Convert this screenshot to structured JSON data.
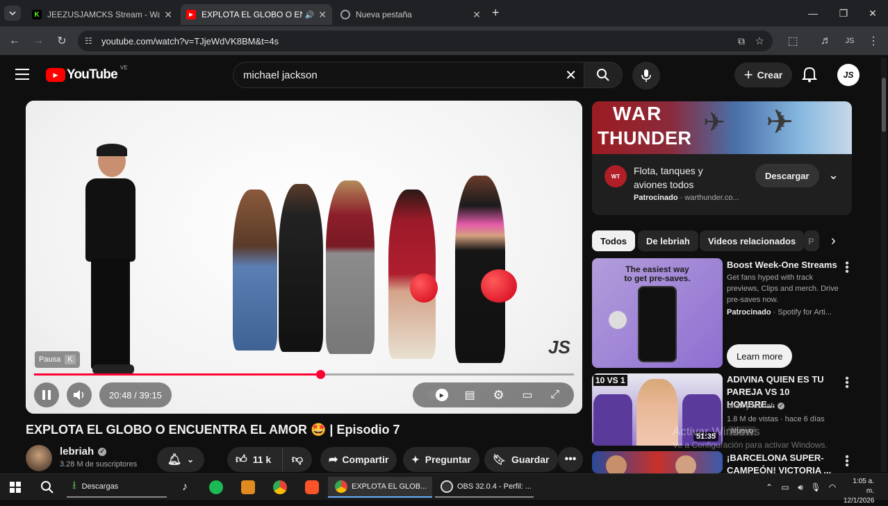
{
  "browser": {
    "tabs": [
      {
        "title": "JEEZUSJAMCKS Stream - Watch",
        "favicon": "kick-icon",
        "color": "#53fc18"
      },
      {
        "title": "EXPLOTA EL GLOBO O ENCU",
        "favicon": "youtube-icon",
        "color": "#ff0000",
        "active": true
      },
      {
        "title": "Nueva pestaña",
        "favicon": "chrome-icon",
        "color": "#9aa0a6"
      }
    ],
    "new_tab": "+",
    "url": "youtube.com/watch?v=TJjeWdVK8BM&t=4s"
  },
  "youtube": {
    "logo_text": "YouTube",
    "region": "VE",
    "search_value": "michael jackson",
    "create_label": "Crear",
    "avatar_text": "JS"
  },
  "player": {
    "pause_tooltip": "Pausa",
    "pause_key": "K",
    "time": "20:48 / 39:15",
    "progress": 0.53,
    "watermark": "JS"
  },
  "video": {
    "title": "EXPLOTA EL GLOBO O ENCUENTRA EL AMOR 🤩 | Episodio 7",
    "channel": "lebriah",
    "subscribers": "3.28 M de suscriptores",
    "likes": "11 k",
    "share_label": "Compartir",
    "ask_label": "Preguntar",
    "save_label": "Guardar"
  },
  "ad": {
    "banner_line1": "WAR",
    "banner_line2": "THUNDER",
    "title": "Flota, tanques y aviones todos",
    "sponsored": "Patrocinado",
    "domain": "· warthunder.co...",
    "cta": "Descargar"
  },
  "chips": [
    "Todos",
    "De lebriah",
    "Videos relacionados",
    "P"
  ],
  "recommendations": [
    {
      "title": "Boost Week-One Streams",
      "desc": "Get fans hyped with track previews, Clips and merch. Drive pre-saves now.",
      "sponsor": "Patrocinado",
      "sponsor_rest": " · Spotify for Arti...",
      "thumb_text": "The easiest way to get pre-saves.",
      "cta": "Learn more"
    },
    {
      "title": "ADIVINA QUIEN ES TU PAREJA VS 10 HOMBRE...",
      "channel": "briah y lebriah",
      "meta": "1.8 M de vistas · hace 6 días",
      "badge": "Nuevo",
      "duration": "51:35",
      "thumb_text": "10 VS 1"
    },
    {
      "title": "¡BARCELONA SUPER-CAMPEÓN! VICTORIA ..."
    }
  ],
  "windows": {
    "watermark_line1": "Activar Windows",
    "watermark_line2": "Ve a Configuración para activar Windows.",
    "taskbar_items": [
      {
        "label": "Descargas",
        "icon": "download-icon"
      },
      {
        "label": "EXPLOTA EL GLOB...",
        "icon": "chrome-icon"
      },
      {
        "label": "OBS 32.0.4 - Perfil: ...",
        "icon": "obs-icon"
      }
    ],
    "time": "1:05 a. m.",
    "date": "12/1/2026"
  }
}
